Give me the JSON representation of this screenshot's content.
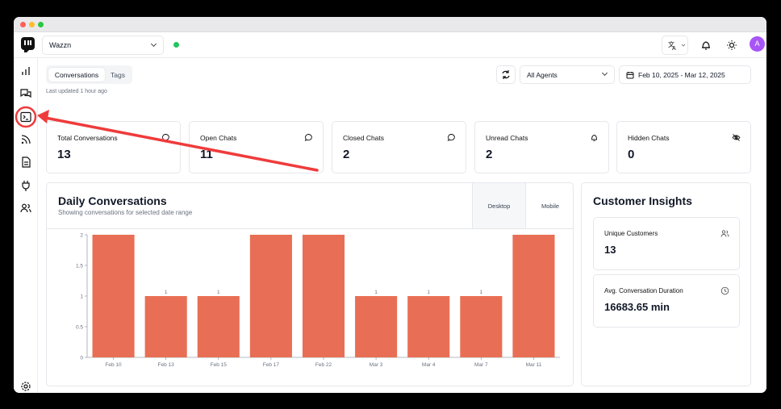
{
  "workspace": {
    "name": "Wazzn"
  },
  "user": {
    "avatar_letter": "A"
  },
  "colors": {
    "accent": "#e86f55",
    "status_online": "#22c55e",
    "avatar": "#a855f7",
    "annotation": "#ef3b3b"
  },
  "sidebar": {
    "items": [
      {
        "icon": "bar-chart-icon"
      },
      {
        "icon": "chat-bubbles-icon"
      },
      {
        "icon": "terminal-icon"
      },
      {
        "icon": "rss-feed-icon"
      },
      {
        "icon": "document-icon"
      },
      {
        "icon": "plug-icon"
      },
      {
        "icon": "users-icon"
      },
      {
        "icon": "settings-gear-icon"
      }
    ]
  },
  "tabs": [
    {
      "label": "Conversations",
      "active": true
    },
    {
      "label": "Tags",
      "active": false
    }
  ],
  "last_updated": "Last updated 1 hour ago",
  "filters": {
    "agent": "All Agents",
    "date_range": "Feb 10, 2025 - Mar 12, 2025"
  },
  "stats": [
    {
      "label": "Total Conversations",
      "value": "13",
      "icon": "chat-bubble-icon"
    },
    {
      "label": "Open Chats",
      "value": "11",
      "icon": "chat-bubble-icon"
    },
    {
      "label": "Closed Chats",
      "value": "2",
      "icon": "chat-bubble-icon"
    },
    {
      "label": "Unread Chats",
      "value": "2",
      "icon": "bell-icon"
    },
    {
      "label": "Hidden Chats",
      "value": "0",
      "icon": "eye-off-icon"
    }
  ],
  "daily": {
    "title": "Daily Conversations",
    "subtitle": "Showing conversations for selected date range",
    "toggle": [
      "Desktop",
      "Mobile"
    ]
  },
  "chart_data": {
    "type": "bar",
    "title": "Daily Conversations",
    "categories": [
      "Feb 10",
      "Feb 13",
      "Feb 15",
      "Feb 17",
      "Feb 22",
      "Mar 3",
      "Mar 4",
      "Mar 7",
      "Mar 11"
    ],
    "values": [
      2,
      1,
      1,
      2,
      2,
      1,
      1,
      1,
      2
    ],
    "data_labels": [
      "",
      "1",
      "1",
      "",
      "",
      "1",
      "1",
      "1",
      ""
    ],
    "yticks": [
      "0",
      "0.5",
      "1",
      "1.5",
      "2"
    ],
    "ylim": [
      0,
      2
    ],
    "color": "#e86f55",
    "grid": false
  },
  "insights": {
    "title": "Customer Insights",
    "items": [
      {
        "label": "Unique Customers",
        "value": "13",
        "icon": "users-icon"
      },
      {
        "label": "Avg. Conversation Duration",
        "value": "16683.65 min",
        "icon": "clock-icon"
      }
    ]
  }
}
